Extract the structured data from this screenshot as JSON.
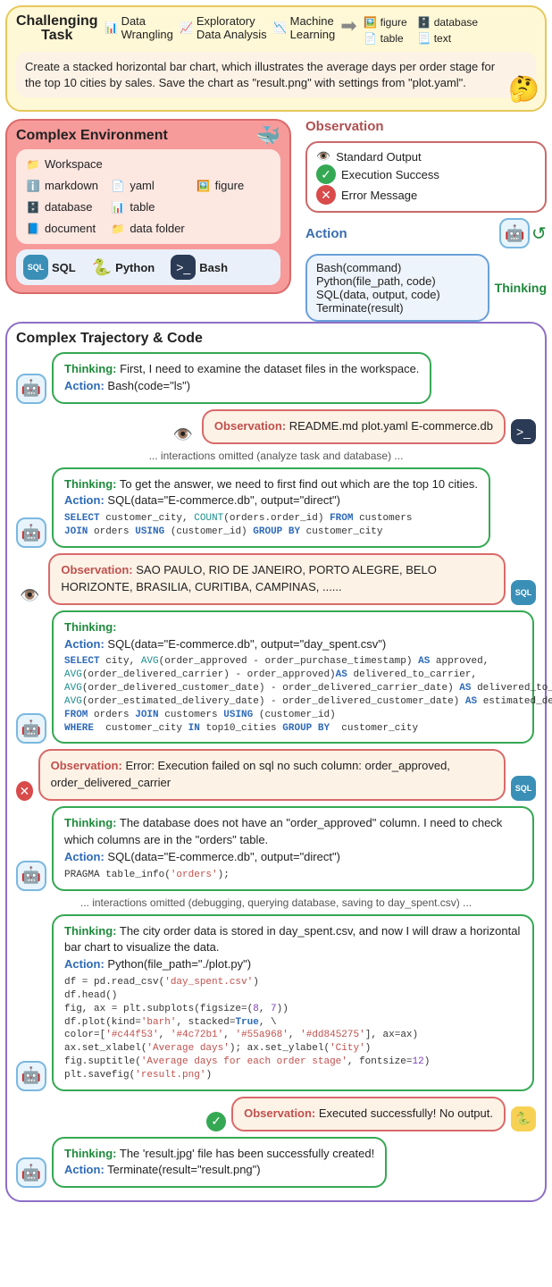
{
  "task": {
    "title_line1": "Challenging",
    "title_line2": "Task",
    "pipeline": [
      {
        "icon": "📊",
        "label_l1": "Data",
        "label_l2": "Wrangling"
      },
      {
        "icon": "📈",
        "label_l1": "Exploratory",
        "label_l2": "Data Analysis"
      },
      {
        "icon": "📉",
        "label_l1": "Machine",
        "label_l2": "Learning"
      }
    ],
    "outputs": [
      {
        "icon": "🖼️",
        "label": "figure",
        "color": "#3a8fb7"
      },
      {
        "icon": "🗄️",
        "label": "database",
        "color": "#e0a63a"
      },
      {
        "icon": "📄",
        "label": "table",
        "color": "#3aa055"
      },
      {
        "icon": "📃",
        "label": "text",
        "color": "#3a8fb7"
      }
    ],
    "description": "Create a stacked horizontal bar chart, which illustrates the average days per order stage for the top 10 cities by sales. Save the chart as \"result.png\" with settings from \"plot.yaml\"."
  },
  "env": {
    "title": "Complex Environment",
    "workspace_label": "Workspace",
    "files": [
      {
        "icon": "ℹ️",
        "label": "markdown",
        "color": "#3a8fb7"
      },
      {
        "icon": "📄",
        "label": "yaml",
        "color": "#d94a4a"
      },
      {
        "icon": "🖼️",
        "label": "figure",
        "color": "#2aa37a"
      },
      {
        "icon": "🗄️",
        "label": "database",
        "color": "#e0a63a"
      },
      {
        "icon": "📊",
        "label": "table",
        "color": "#3aa055"
      },
      {
        "icon": "📘",
        "label": "document",
        "color": "#3a8fb7"
      },
      {
        "icon": "📁",
        "label": "data folder",
        "color": "#e0a63a"
      }
    ],
    "tools": [
      {
        "icon": "🐘",
        "label": "SQL"
      },
      {
        "icon": "🐍",
        "label": "Python"
      },
      {
        "icon": ">_",
        "label": "Bash"
      }
    ]
  },
  "observation": {
    "title": "Observation",
    "items": [
      {
        "icon": "👁️",
        "label": "Standard Output"
      },
      {
        "icon": "✅",
        "label": "Execution Success"
      },
      {
        "icon": "❌",
        "label": "Error Message"
      }
    ]
  },
  "action": {
    "title": "Action",
    "items": [
      "Bash(command)",
      "Python(file_path, code)",
      "SQL(data, output, code)",
      "Terminate(result)"
    ]
  },
  "thinking_label": "Thinking",
  "trajectory": {
    "title": "Complex Trajectory & Code",
    "steps": [
      {
        "type": "ta",
        "thinking": "First, I need to examine the dataset files in the workspace.",
        "action_prefix": "Action:",
        "action": " Bash(code=\"ls\")"
      },
      {
        "type": "obs",
        "icon": "eye",
        "text": "README.md  plot.yaml E-commerce.db",
        "badge": "term"
      },
      {
        "type": "omit",
        "text": "... interactions omitted (analyze task and database) ..."
      },
      {
        "type": "ta",
        "thinking": "To get the answer, we need to first find out which are the top 10 cities.",
        "action_prefix": "Action:",
        "action": " SQL(data=\"E-commerce.db\", output=\"direct\")",
        "code_html": "<span class='kw-blue'>SELECT</span> customer_city, <span class='kw-teal'>COUNT</span>(orders.order_id) <span class='kw-blue'>FROM</span> customers\n<span class='kw-blue'>JOIN</span> orders <span class='kw-blue'>USING</span> (customer_id) <span class='kw-blue'>GROUP BY</span> customer_city"
      },
      {
        "type": "obs",
        "icon": "eye",
        "text": "SAO PAULO, RIO DE JANEIRO, PORTO ALEGRE, BELO HORIZONTE, BRASILIA, CURITIBA, CAMPINAS, ......",
        "badge": "sql"
      },
      {
        "type": "ta",
        "thinking": "",
        "action_prefix": "Action:",
        "action": " SQL(data=\"E-commerce.db\", output=\"day_spent.csv\")",
        "code_html": "<span class='kw-blue'>SELECT</span> city, <span class='kw-teal'>AVG</span>(order_approved - order_purchase_timestamp) <span class='kw-blue'>AS</span> approved,\n<span class='kw-teal'>AVG</span>(order_delivered_carrier) - order_approved)<span class='kw-blue'>AS</span> delivered_to_carrier,\n<span class='kw-teal'>AVG</span>(order_delivered_customer_date) - order_delivered_carrier_date) <span class='kw-blue'>AS</span> delivered_to_customer,\n<span class='kw-teal'>AVG</span>(order_estimated_delivery_date) - order_delivered_customer_date) <span class='kw-blue'>AS</span> estimated_delivery\n<span class='kw-blue'>FROM</span> orders <span class='kw-blue'>JOIN</span> customers <span class='kw-blue'>USING</span> (customer_id)\n<span class='kw-blue'>WHERE</span>  customer_city <span class='kw-blue'>IN</span> top10_cities <span class='kw-blue'>GROUP BY</span>  customer_city"
      },
      {
        "type": "obs",
        "icon": "cross",
        "text": "Error: Execution failed on sql no such column: order_approved, order_delivered_carrier",
        "badge": "sql"
      },
      {
        "type": "ta",
        "thinking": "The database does not have an \"order_approved\" column. I need to check which columns are in the \"orders\" table.",
        "action_prefix": "Action:",
        "action": " SQL(data=\"E-commerce.db\", output=\"direct\")",
        "code_html": "PRAGMA table_info(<span class='kw-red'>'orders'</span>);"
      },
      {
        "type": "omit",
        "text": "... interactions omitted (debugging, querying database, saving to day_spent.csv) ..."
      },
      {
        "type": "ta",
        "thinking": "The city order data is stored in day_spent.csv, and now I will draw a horizontal bar chart to visualize the data.",
        "action_prefix": "Action:",
        "action": " Python(file_path=\"./plot.py\")",
        "code_html": "df = pd.read_csv(<span class='kw-red'>'day_spent.csv'</span>)\ndf.head()\nfig, ax = plt.subplots(figsize=(<span class='kw-purple'>8</span>, <span class='kw-purple'>7</span>))\ndf.plot(kind=<span class='kw-red'>'barh'</span>, stacked=<span class='kw-blue'>True</span>, \\\ncolor=[<span class='kw-red'>'#c44f53'</span>, <span class='kw-red'>'#4c72b1'</span>, <span class='kw-red'>'#55a968'</span>, <span class='kw-red'>'#dd845275'</span>], ax=ax)\nax.set_xlabel(<span class='kw-red'>'Average days'</span>); ax.set_ylabel(<span class='kw-red'>'City'</span>)\nfig.suptitle(<span class='kw-red'>'Average days for each order stage'</span>, fontsize=<span class='kw-purple'>12</span>)\nplt.savefig(<span class='kw-red'>'result.png'</span>)"
      },
      {
        "type": "obs",
        "icon": "check",
        "text": "Executed successfully! No output.",
        "badge": "py"
      },
      {
        "type": "ta",
        "thinking": "The 'result.jpg' file has been successfully created!",
        "action_prefix": "Action:",
        "action": " Terminate(result=\"result.png\")"
      }
    ]
  }
}
